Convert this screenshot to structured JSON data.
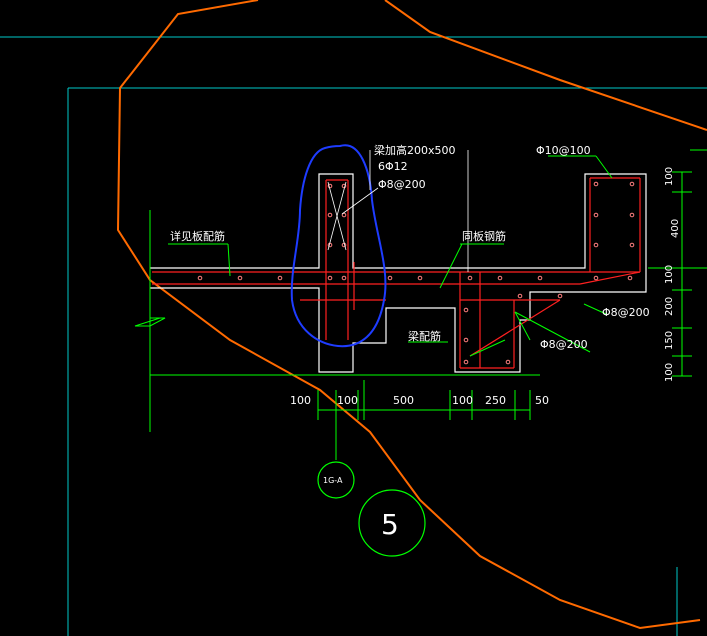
{
  "colors": {
    "background": "#000000",
    "border": "#00c8c8",
    "outline": "#ffffff",
    "rebar": "#ff2020",
    "dimension": "#00ff00",
    "section_line": "#ff6a00",
    "markup": "#1e3cff"
  },
  "annotations": {
    "column_size": "梁加高200x500",
    "column_bars": "6Φ12",
    "column_stirrup": "Φ8@200",
    "top_bar_right": "Φ10@100",
    "see_slab": "详见板配筋",
    "distribution_bar": "同板钢筋",
    "beam_rebar": "梁配筋",
    "stirrup_right_1": "Φ8@200",
    "stirrup_right_2": "Φ8@200"
  },
  "dimensions": {
    "horizontal": [
      "100",
      "100",
      "500",
      "100",
      "250",
      "50"
    ],
    "vertical": [
      "100",
      "400",
      "100",
      "200",
      "150",
      "100"
    ]
  },
  "markers": {
    "axis_label": "1G-A",
    "section_number": "5"
  }
}
